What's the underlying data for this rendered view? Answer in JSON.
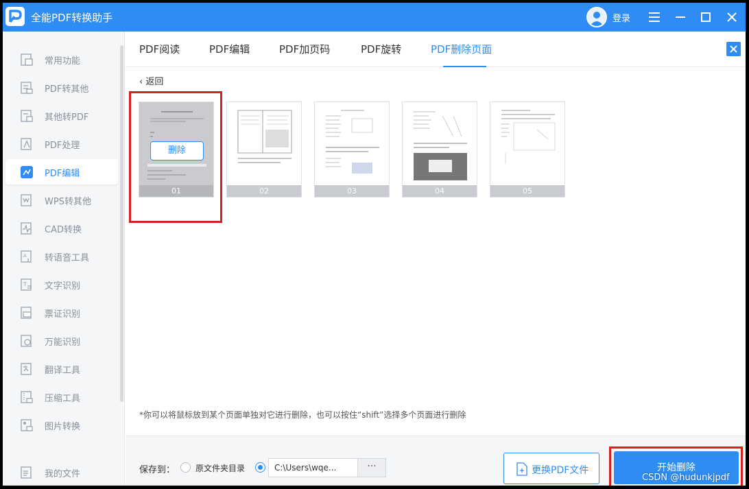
{
  "app": {
    "title": "全能PDF转换助手",
    "login_label": "登录",
    "logo_letter": "P",
    "accent_color": "#2f8cf2"
  },
  "titlebar_icons": [
    "avatar-icon",
    "menu-icon",
    "minimize-icon",
    "maximize-icon",
    "close-icon"
  ],
  "sidebar": {
    "items": [
      {
        "label": "常用功能",
        "icon": "common-functions-icon"
      },
      {
        "label": "PDF转其他",
        "icon": "pdf-to-other-icon"
      },
      {
        "label": "其他转PDF",
        "icon": "other-to-pdf-icon"
      },
      {
        "label": "PDF处理",
        "icon": "pdf-process-icon"
      },
      {
        "label": "PDF编辑",
        "icon": "pdf-edit-icon",
        "active": true
      },
      {
        "label": "WPS转其他",
        "icon": "wps-convert-icon"
      },
      {
        "label": "CAD转换",
        "icon": "cad-convert-icon"
      },
      {
        "label": "转语音工具",
        "icon": "text-to-speech-icon"
      },
      {
        "label": "文字识别",
        "icon": "ocr-icon"
      },
      {
        "label": "票证识别",
        "icon": "ticket-recognition-icon"
      },
      {
        "label": "万能识别",
        "icon": "universal-recognition-icon"
      },
      {
        "label": "翻译工具",
        "icon": "translate-icon"
      },
      {
        "label": "压缩工具",
        "icon": "compress-icon"
      },
      {
        "label": "图片转换",
        "icon": "image-convert-icon"
      }
    ],
    "bottom_item": {
      "label": "我的文件",
      "icon": "my-files-icon"
    }
  },
  "tabs": [
    {
      "label": "PDF阅读"
    },
    {
      "label": "PDF编辑"
    },
    {
      "label": "PDF加页码"
    },
    {
      "label": "PDF旋转"
    },
    {
      "label": "PDF删除页面",
      "active": true
    }
  ],
  "content": {
    "back_label": "返回",
    "delete_button_label": "删除",
    "pages": [
      "01",
      "02",
      "03",
      "04",
      "05"
    ],
    "hint": "*你可以将鼠标放到某个页面单独对它进行删除，也可以按住“shift”选择多个页面进行删除"
  },
  "footer": {
    "save_to_label": "保存到：",
    "option_source_dir": "原文件夹目录",
    "custom_path": "C:\\Users\\wqe...",
    "more_label": "···",
    "change_pdf_label": "更换PDF文件",
    "start_delete_label": "开始删除"
  },
  "watermark": "CSDN @hudunkjpdf"
}
